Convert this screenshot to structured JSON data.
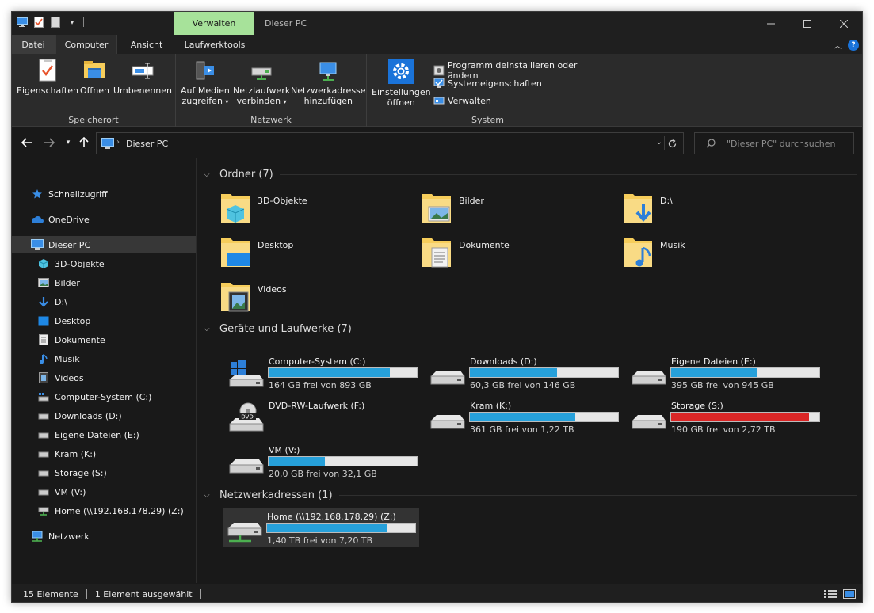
{
  "titlebar": {
    "context_tab": "Verwalten",
    "window_title": "Dieser PC"
  },
  "tabs": {
    "datei": "Datei",
    "computer": "Computer",
    "ansicht": "Ansicht",
    "laufwerktools": "Laufwerktools"
  },
  "ribbon": {
    "speicherort": {
      "label": "Speicherort",
      "eigenschaften": "Eigenschaften",
      "oeffnen": "Öffnen",
      "umbenennen": "Umbenennen"
    },
    "netzwerk": {
      "label": "Netzwerk",
      "medien_line1": "Auf Medien",
      "medien_line2": "zugreifen",
      "netzlaufwerk_line1": "Netzlaufwerk",
      "netzlaufwerk_line2": "verbinden",
      "netzadresse_line1": "Netzwerkadresse",
      "netzadresse_line2": "hinzufügen"
    },
    "system": {
      "label": "System",
      "einstellungen_line1": "Einstellungen",
      "einstellungen_line2": "öffnen",
      "deinstallieren": "Programm deinstallieren oder ändern",
      "systemeigenschaften": "Systemeigenschaften",
      "verwalten": "Verwalten"
    }
  },
  "address": {
    "path": "Dieser PC",
    "search_placeholder": "\"Dieser PC\" durchsuchen"
  },
  "nav": {
    "schnellzugriff": "Schnellzugriff",
    "onedrive": "OneDrive",
    "dieserpc": "Dieser PC",
    "items": [
      "3D-Objekte",
      "Bilder",
      "D:\\",
      "Desktop",
      "Dokumente",
      "Musik",
      "Videos",
      "Computer-System (C:)",
      "Downloads (D:)",
      "Eigene Dateien (E:)",
      "Kram (K:)",
      "Storage (S:)",
      "VM (V:)",
      "Home (\\\\192.168.178.29) (Z:)"
    ],
    "netzwerk": "Netzwerk"
  },
  "sections": {
    "ordner": "Ordner (7)",
    "geraete": "Geräte und Laufwerke (7)",
    "netzwerk": "Netzwerkadressen (1)"
  },
  "folders": [
    "3D-Objekte",
    "Bilder",
    "D:\\",
    "Desktop",
    "Dokumente",
    "Musik",
    "Videos"
  ],
  "drives": [
    {
      "name": "Computer-System (C:)",
      "free": "164 GB frei von 893 GB",
      "used_fraction": 0.82
    },
    {
      "name": "Downloads (D:)",
      "free": "60,3 GB frei von 146 GB",
      "used_fraction": 0.59
    },
    {
      "name": "Eigene Dateien (E:)",
      "free": "395 GB frei von 945 GB",
      "used_fraction": 0.58
    },
    {
      "name": "DVD-RW-Laufwerk (F:)"
    },
    {
      "name": "Kram (K:)",
      "free": "361 GB frei von 1,22 TB",
      "used_fraction": 0.71
    },
    {
      "name": "Storage (S:)",
      "free": "190 GB frei von 2,72 TB",
      "used_fraction": 0.93
    },
    {
      "name": "VM (V:)",
      "free": "20,0 GB frei von 32,1 GB",
      "used_fraction": 0.38
    }
  ],
  "network_drive": {
    "name": "Home (\\\\192.168.178.29) (Z:)",
    "free": "1,40 TB frei von 7,20 TB",
    "used_fraction": 0.81
  },
  "status": {
    "count": "15 Elemente",
    "selected": "1 Element ausgewählt"
  },
  "colors": {
    "accent": "#26a0da",
    "warning_bar": "#da2626",
    "context_tab": "#a7e29a",
    "folder_yellow": "#f6cd5b"
  }
}
